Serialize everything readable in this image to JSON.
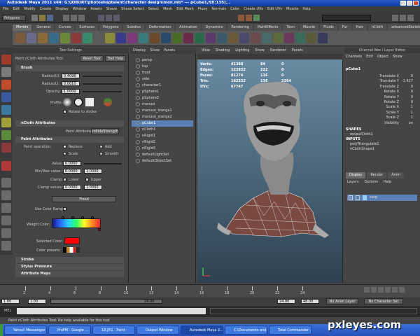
{
  "title_bar": {
    "title": "Autodesk Maya 2011 x64: G:\\JOBURT\\photoshoptalent\\character design\\mon.mb* --- pCube1,f[0:135]..."
  },
  "menu_bar": {
    "items": [
      "File",
      "Edit",
      "Modify",
      "Create",
      "Display",
      "Window",
      "Assets",
      "Shave",
      "Shave Select",
      "Select",
      "Mesh",
      "Edit Mesh",
      "Proxy",
      "Normals",
      "Color",
      "Create UVs",
      "Edit UVs",
      "Muscle",
      "Help"
    ]
  },
  "status_line": {
    "menu_set": "Polygons"
  },
  "shelf": {
    "tabs": [
      "Mirrors",
      "General",
      "Curves",
      "Surfaces",
      "Polygons",
      "Subdivs",
      "Deformation",
      "Animation",
      "Dynamics",
      "Rendering",
      "PaintEffects",
      "Toon",
      "Muscle",
      "Fluids",
      "Fur",
      "Hair",
      "nCloth",
      "advancedSkeleton"
    ],
    "active_tab": "Mirrors"
  },
  "tool_settings": {
    "header": "Tool Settings",
    "tool_name": "Paint nCloth Attributes Tool",
    "reset_button": "Reset Tool",
    "help_button": "Tool Help",
    "brush": {
      "title": "Brush",
      "radius_u_label": "Radius(U):",
      "radius_u": "0.4096",
      "radius_l_label": "Radius(L):",
      "radius_l": "0.0010",
      "opacity_label": "Opacity:",
      "opacity": "1.0000",
      "profile_label": "Profile:",
      "rotate_label": "Rotate to stroke"
    },
    "ncloth": {
      "title": "nCloth Attributes",
      "paint_attr_label": "Paint Attribute",
      "paint_attr_value": "collideStrength"
    },
    "paint": {
      "title": "Paint Attributes",
      "operation_label": "Paint operation:",
      "op_replace": "Replace",
      "op_add": "Add",
      "op_scale": "Scale",
      "op_smooth": "Smooth",
      "value_label": "Value:",
      "value": "0.0000",
      "minmax_label": "Min/Max value:",
      "min": "0.0000",
      "max": "1.0000",
      "clamp_label": "Clamp:",
      "clamp_lower": "Lower",
      "clamp_upper": "Upper",
      "clamp_values_label": "Clamp values:",
      "clamp_min": "0.0000",
      "clamp_max": "1.0000",
      "flood_button": "Flood",
      "color_ramp_label": "Use Color Ramp",
      "weight_color_label": "Weight Color:",
      "selected_color_label": "Selected Color:",
      "color_presets_label": "Color presets:"
    },
    "collapsed_sections": [
      "Stroke",
      "Stylus Pressure",
      "Attribute Maps"
    ]
  },
  "outliner": {
    "menu": [
      "Display",
      "Show",
      "Panels"
    ],
    "items": [
      "persp",
      "top",
      "front",
      "side",
      "character1",
      "pSphere1",
      "pSphere2",
      "manusi",
      "manuso_stanga1",
      "manuso_stanga2",
      "pCube1",
      "nCloth1",
      "nRigid1",
      "nRigid2",
      "nRigid3",
      "defaultLightSet",
      "defaultObjectSet"
    ],
    "selected": "pCube1"
  },
  "viewport": {
    "menu": [
      "View",
      "Shading",
      "Lighting",
      "Show",
      "Renderer",
      "Panels"
    ],
    "hud": [
      {
        "label": "Verts:",
        "a": "41388",
        "b": "84",
        "c": "0"
      },
      {
        "label": "Edges:",
        "a": "122832",
        "b": "222",
        "c": "0"
      },
      {
        "label": "Faces:",
        "a": "81274",
        "b": "136",
        "c": "0"
      },
      {
        "label": "Tris:",
        "a": "162332",
        "b": "136",
        "c": "2264"
      },
      {
        "label": "UVs:",
        "a": "67747",
        "b": "168",
        "c": "0"
      }
    ]
  },
  "channel_box": {
    "header": "Channel Box / Layer Editor",
    "menu": [
      "Channels",
      "Edit",
      "Object",
      "Show"
    ],
    "object": "pCube1",
    "channels": [
      {
        "name": "Translate X",
        "value": "0"
      },
      {
        "name": "Translate Y",
        "value": "-1.617"
      },
      {
        "name": "Translate Z",
        "value": "0"
      },
      {
        "name": "Rotate X",
        "value": "0"
      },
      {
        "name": "Rotate Y",
        "value": "0"
      },
      {
        "name": "Rotate Z",
        "value": "0"
      },
      {
        "name": "Scale X",
        "value": "1"
      },
      {
        "name": "Scale Y",
        "value": "1"
      },
      {
        "name": "Scale Z",
        "value": "1"
      },
      {
        "name": "Visibility",
        "value": "on"
      }
    ],
    "shapes_label": "SHAPES",
    "shape": "outputCloth1",
    "inputs_label": "INPUTS",
    "inputs": [
      "polyTriangulate1",
      "nClothShape1"
    ]
  },
  "layer_editor": {
    "tabs": [
      "Display",
      "Render",
      "Anim"
    ],
    "menu": [
      "Layers",
      "Options",
      "Help"
    ],
    "layer": "carp"
  },
  "time_slider": {
    "ticks": [
      "2",
      "4",
      "6",
      "8",
      "10",
      "12",
      "14",
      "16",
      "18",
      "20",
      "22",
      "24"
    ],
    "current": "1.00"
  },
  "range_slider": {
    "start": "1.00",
    "range_start": "1.00",
    "range_end": "24.00",
    "end": "24.00",
    "end2": "48.00",
    "anim_layer": "No Anim Layer",
    "char_set": "No Character Set"
  },
  "mel": {
    "label": "MEL"
  },
  "help_line": {
    "text": "Paint nCloth Attributes Tool: No help available for this tool"
  },
  "taskbar": {
    "items": [
      "Yahoo! Messenger",
      "ProFM - Google ...",
      "18.JPG - Paint",
      "Output Window",
      "Autodesk Maya 2...",
      "C:\\Documents and...",
      "Total Commander ..."
    ],
    "active": "Autodesk Maya 2..."
  },
  "watermark": "pxleyes.com"
}
